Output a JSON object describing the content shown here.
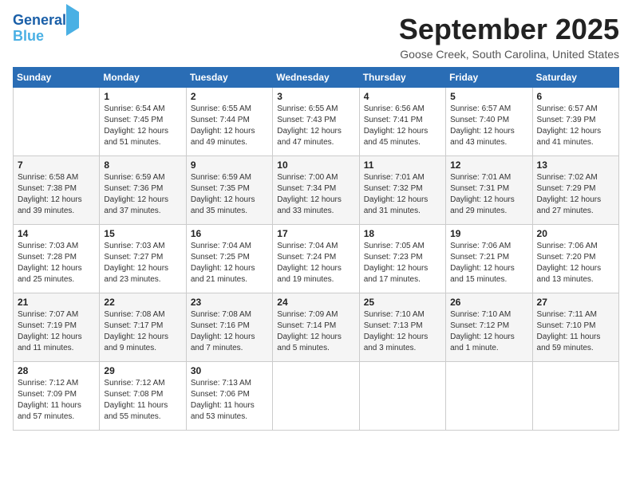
{
  "logo": {
    "line1": "General",
    "line2": "Blue"
  },
  "title": "September 2025",
  "location": "Goose Creek, South Carolina, United States",
  "weekdays": [
    "Sunday",
    "Monday",
    "Tuesday",
    "Wednesday",
    "Thursday",
    "Friday",
    "Saturday"
  ],
  "weeks": [
    [
      {
        "day": "",
        "sunrise": "",
        "sunset": "",
        "daylight": ""
      },
      {
        "day": "1",
        "sunrise": "Sunrise: 6:54 AM",
        "sunset": "Sunset: 7:45 PM",
        "daylight": "Daylight: 12 hours and 51 minutes."
      },
      {
        "day": "2",
        "sunrise": "Sunrise: 6:55 AM",
        "sunset": "Sunset: 7:44 PM",
        "daylight": "Daylight: 12 hours and 49 minutes."
      },
      {
        "day": "3",
        "sunrise": "Sunrise: 6:55 AM",
        "sunset": "Sunset: 7:43 PM",
        "daylight": "Daylight: 12 hours and 47 minutes."
      },
      {
        "day": "4",
        "sunrise": "Sunrise: 6:56 AM",
        "sunset": "Sunset: 7:41 PM",
        "daylight": "Daylight: 12 hours and 45 minutes."
      },
      {
        "day": "5",
        "sunrise": "Sunrise: 6:57 AM",
        "sunset": "Sunset: 7:40 PM",
        "daylight": "Daylight: 12 hours and 43 minutes."
      },
      {
        "day": "6",
        "sunrise": "Sunrise: 6:57 AM",
        "sunset": "Sunset: 7:39 PM",
        "daylight": "Daylight: 12 hours and 41 minutes."
      }
    ],
    [
      {
        "day": "7",
        "sunrise": "Sunrise: 6:58 AM",
        "sunset": "Sunset: 7:38 PM",
        "daylight": "Daylight: 12 hours and 39 minutes."
      },
      {
        "day": "8",
        "sunrise": "Sunrise: 6:59 AM",
        "sunset": "Sunset: 7:36 PM",
        "daylight": "Daylight: 12 hours and 37 minutes."
      },
      {
        "day": "9",
        "sunrise": "Sunrise: 6:59 AM",
        "sunset": "Sunset: 7:35 PM",
        "daylight": "Daylight: 12 hours and 35 minutes."
      },
      {
        "day": "10",
        "sunrise": "Sunrise: 7:00 AM",
        "sunset": "Sunset: 7:34 PM",
        "daylight": "Daylight: 12 hours and 33 minutes."
      },
      {
        "day": "11",
        "sunrise": "Sunrise: 7:01 AM",
        "sunset": "Sunset: 7:32 PM",
        "daylight": "Daylight: 12 hours and 31 minutes."
      },
      {
        "day": "12",
        "sunrise": "Sunrise: 7:01 AM",
        "sunset": "Sunset: 7:31 PM",
        "daylight": "Daylight: 12 hours and 29 minutes."
      },
      {
        "day": "13",
        "sunrise": "Sunrise: 7:02 AM",
        "sunset": "Sunset: 7:29 PM",
        "daylight": "Daylight: 12 hours and 27 minutes."
      }
    ],
    [
      {
        "day": "14",
        "sunrise": "Sunrise: 7:03 AM",
        "sunset": "Sunset: 7:28 PM",
        "daylight": "Daylight: 12 hours and 25 minutes."
      },
      {
        "day": "15",
        "sunrise": "Sunrise: 7:03 AM",
        "sunset": "Sunset: 7:27 PM",
        "daylight": "Daylight: 12 hours and 23 minutes."
      },
      {
        "day": "16",
        "sunrise": "Sunrise: 7:04 AM",
        "sunset": "Sunset: 7:25 PM",
        "daylight": "Daylight: 12 hours and 21 minutes."
      },
      {
        "day": "17",
        "sunrise": "Sunrise: 7:04 AM",
        "sunset": "Sunset: 7:24 PM",
        "daylight": "Daylight: 12 hours and 19 minutes."
      },
      {
        "day": "18",
        "sunrise": "Sunrise: 7:05 AM",
        "sunset": "Sunset: 7:23 PM",
        "daylight": "Daylight: 12 hours and 17 minutes."
      },
      {
        "day": "19",
        "sunrise": "Sunrise: 7:06 AM",
        "sunset": "Sunset: 7:21 PM",
        "daylight": "Daylight: 12 hours and 15 minutes."
      },
      {
        "day": "20",
        "sunrise": "Sunrise: 7:06 AM",
        "sunset": "Sunset: 7:20 PM",
        "daylight": "Daylight: 12 hours and 13 minutes."
      }
    ],
    [
      {
        "day": "21",
        "sunrise": "Sunrise: 7:07 AM",
        "sunset": "Sunset: 7:19 PM",
        "daylight": "Daylight: 12 hours and 11 minutes."
      },
      {
        "day": "22",
        "sunrise": "Sunrise: 7:08 AM",
        "sunset": "Sunset: 7:17 PM",
        "daylight": "Daylight: 12 hours and 9 minutes."
      },
      {
        "day": "23",
        "sunrise": "Sunrise: 7:08 AM",
        "sunset": "Sunset: 7:16 PM",
        "daylight": "Daylight: 12 hours and 7 minutes."
      },
      {
        "day": "24",
        "sunrise": "Sunrise: 7:09 AM",
        "sunset": "Sunset: 7:14 PM",
        "daylight": "Daylight: 12 hours and 5 minutes."
      },
      {
        "day": "25",
        "sunrise": "Sunrise: 7:10 AM",
        "sunset": "Sunset: 7:13 PM",
        "daylight": "Daylight: 12 hours and 3 minutes."
      },
      {
        "day": "26",
        "sunrise": "Sunrise: 7:10 AM",
        "sunset": "Sunset: 7:12 PM",
        "daylight": "Daylight: 12 hours and 1 minute."
      },
      {
        "day": "27",
        "sunrise": "Sunrise: 7:11 AM",
        "sunset": "Sunset: 7:10 PM",
        "daylight": "Daylight: 11 hours and 59 minutes."
      }
    ],
    [
      {
        "day": "28",
        "sunrise": "Sunrise: 7:12 AM",
        "sunset": "Sunset: 7:09 PM",
        "daylight": "Daylight: 11 hours and 57 minutes."
      },
      {
        "day": "29",
        "sunrise": "Sunrise: 7:12 AM",
        "sunset": "Sunset: 7:08 PM",
        "daylight": "Daylight: 11 hours and 55 minutes."
      },
      {
        "day": "30",
        "sunrise": "Sunrise: 7:13 AM",
        "sunset": "Sunset: 7:06 PM",
        "daylight": "Daylight: 11 hours and 53 minutes."
      },
      {
        "day": "",
        "sunrise": "",
        "sunset": "",
        "daylight": ""
      },
      {
        "day": "",
        "sunrise": "",
        "sunset": "",
        "daylight": ""
      },
      {
        "day": "",
        "sunrise": "",
        "sunset": "",
        "daylight": ""
      },
      {
        "day": "",
        "sunrise": "",
        "sunset": "",
        "daylight": ""
      }
    ]
  ]
}
